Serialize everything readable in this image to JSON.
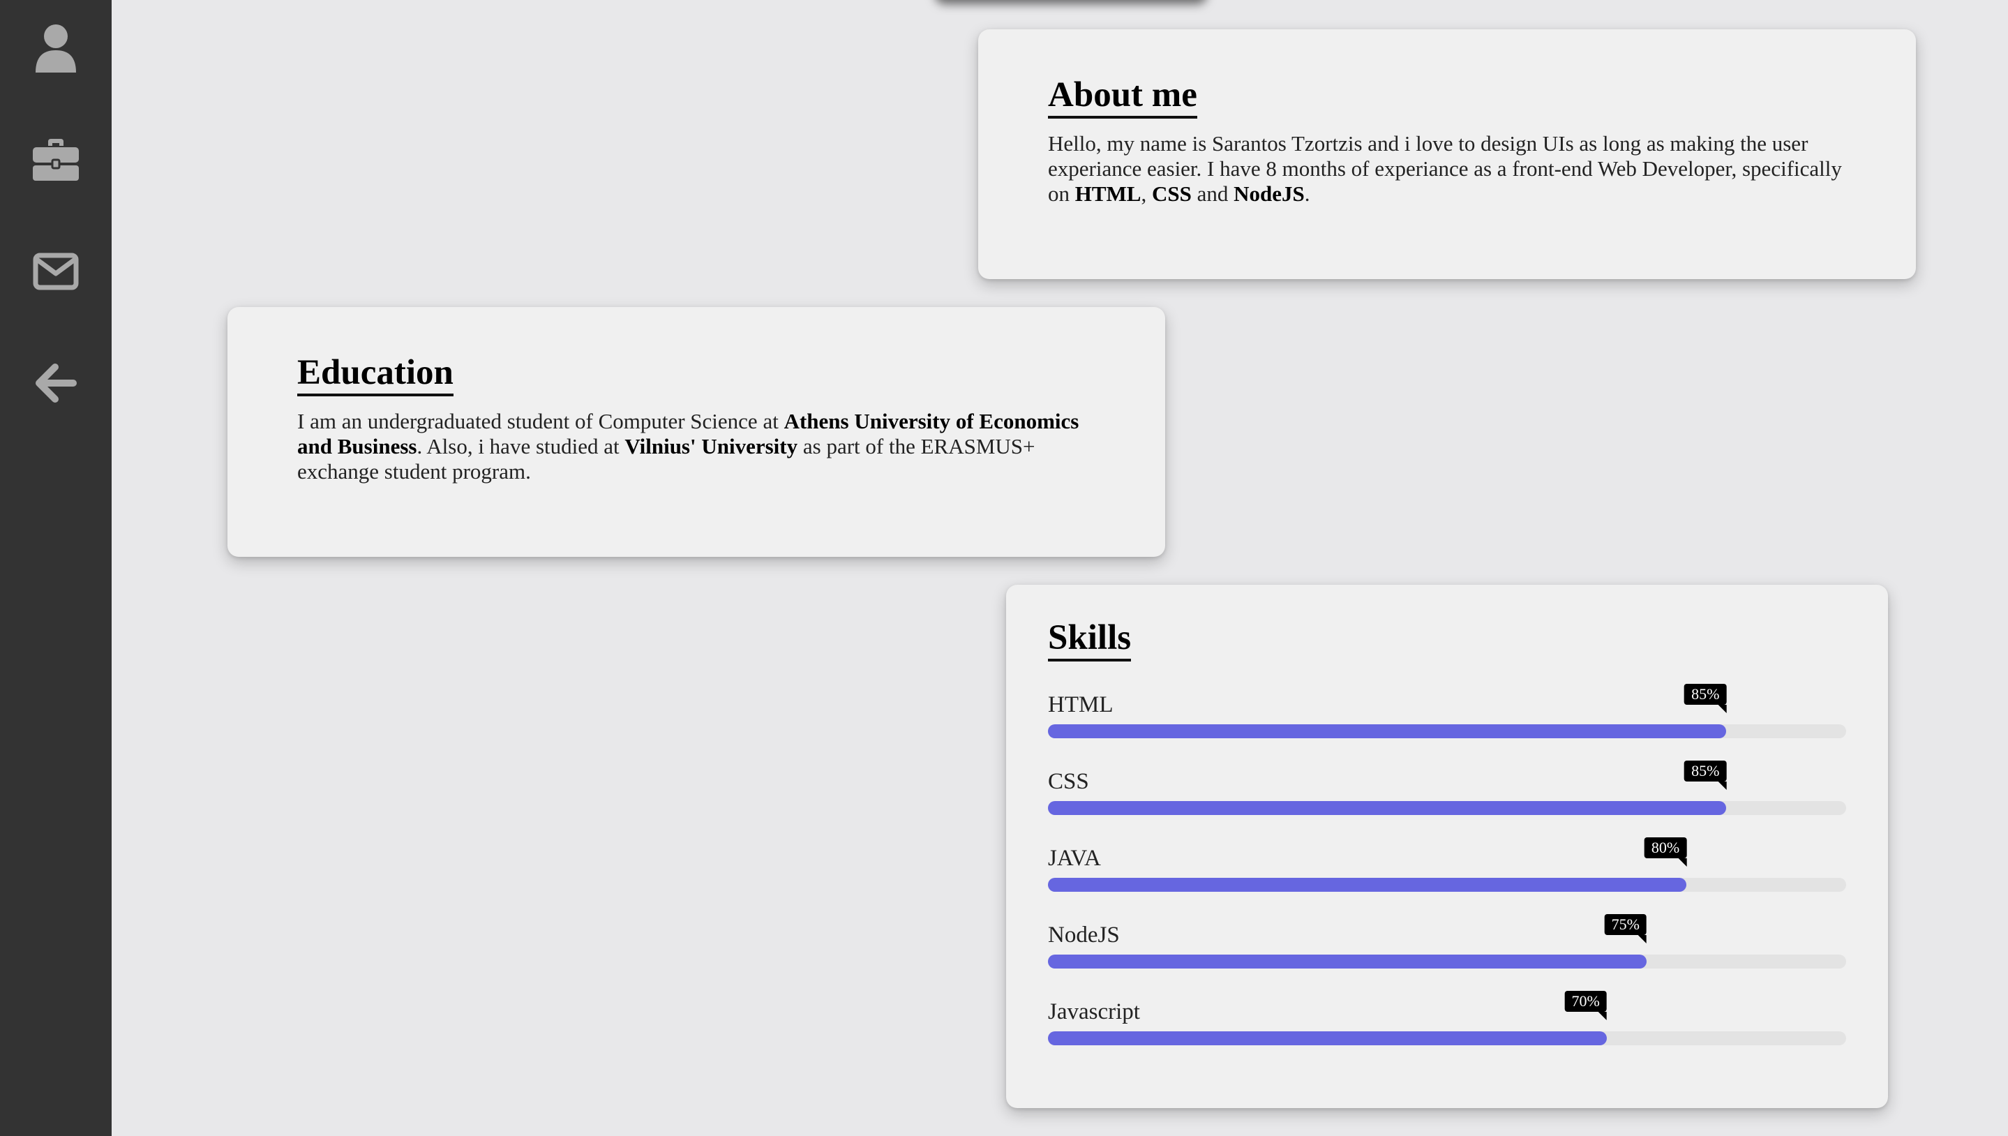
{
  "sidebar": {
    "items": [
      {
        "icon": "user-icon",
        "name": "profile"
      },
      {
        "icon": "briefcase-icon",
        "name": "work"
      },
      {
        "icon": "mail-icon",
        "name": "contact"
      },
      {
        "icon": "arrow-left-icon",
        "name": "back"
      }
    ],
    "icon_color": "#a9a9a9",
    "background": "#333333"
  },
  "about": {
    "title": "About me",
    "text_1": "Hello, my name is Sarantos Tzortzis and i love to design UIs as long as making the user experiance easier. I have 8 months of experiance as a front-end Web Developer, specifically on ",
    "strong_1": "HTML",
    "text_2": ", ",
    "strong_2": "CSS",
    "text_3": " and ",
    "strong_3": "NodeJS",
    "text_4": "."
  },
  "education": {
    "title": "Education",
    "text_1": "I am an undergraduated student of Computer Science at ",
    "strong_1": "Athens University of Economics and Business",
    "text_2": ". Also, i have studied at ",
    "strong_2": "Vilnius' University",
    "text_3": " as part of the ERASMUS+ exchange student program."
  },
  "skills": {
    "title": "Skills",
    "bar_color": "#6666e0",
    "track_color": "#e3e3e3",
    "items": [
      {
        "name": "HTML",
        "percent_label": "85%",
        "value": 0.85
      },
      {
        "name": "CSS",
        "percent_label": "85%",
        "value": 0.85
      },
      {
        "name": "JAVA",
        "percent_label": "80%",
        "value": 0.8
      },
      {
        "name": "NodeJS",
        "percent_label": "75%",
        "value": 0.75
      },
      {
        "name": "Javascript",
        "percent_label": "70%",
        "value": 0.7
      }
    ]
  }
}
